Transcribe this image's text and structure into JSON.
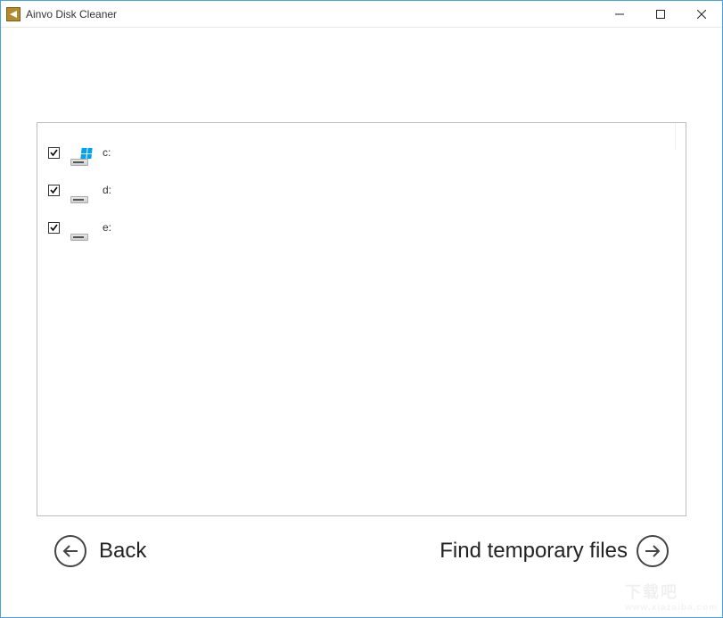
{
  "window": {
    "title": "Ainvo Disk Cleaner"
  },
  "drives": [
    {
      "label": "c:",
      "checked": true,
      "is_system": true
    },
    {
      "label": "d:",
      "checked": true,
      "is_system": false
    },
    {
      "label": "e:",
      "checked": true,
      "is_system": false
    }
  ],
  "footer": {
    "back_label": "Back",
    "forward_label": "Find temporary files"
  },
  "watermark": {
    "main": "下载吧",
    "sub": "www.xiazaiba.com"
  }
}
